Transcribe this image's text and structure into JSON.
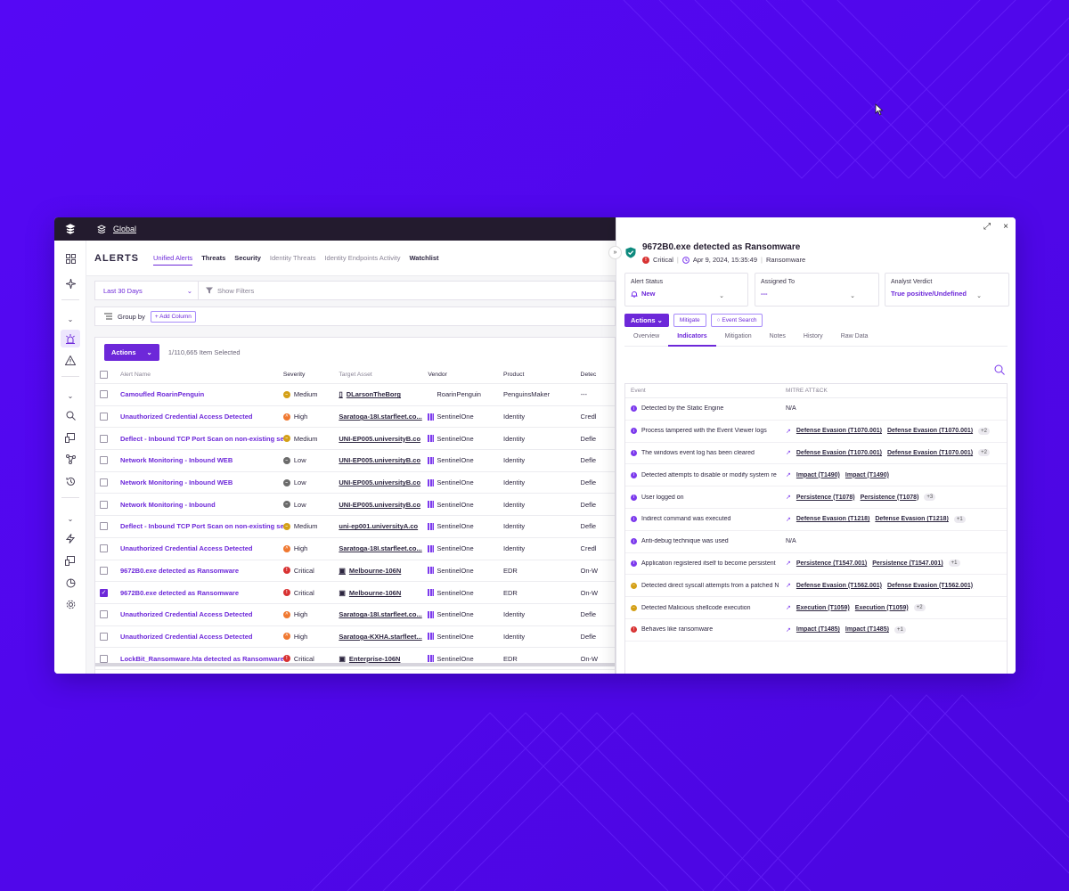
{
  "colors": {
    "accent": "#6d28d9",
    "background": "#5a0ff0",
    "topbar": "#231b2e"
  },
  "topbar": {
    "scope": "Global"
  },
  "header": {
    "title": "ALERTS",
    "tabs": [
      "Unified Alerts",
      "Threats",
      "Security",
      "Identity Threats",
      "Identity Endpoints Activity",
      "Watchlist"
    ]
  },
  "filters": {
    "date_range": "Last 30 Days",
    "show_filters": "Show Filters"
  },
  "group": {
    "label": "Group by",
    "add_column": "+ Add Column"
  },
  "table": {
    "actions_label": "Actions",
    "selection": "1/110,665 Item Selected",
    "columns": [
      "Alert Name",
      "Severity",
      "Target Asset",
      "Vendor",
      "Product",
      "Detec"
    ],
    "rows": [
      {
        "name": "Camoufled RoarinPenguin",
        "severity": "Medium",
        "asset": "DLarsonTheBorg",
        "vendor": "RoarinPenguin",
        "product": "PenguinsMaker",
        "detection": "---"
      },
      {
        "name": "Unauthorized Credential Access Detected",
        "severity": "High",
        "asset": "Saratoga-18I.starfleet.co...",
        "vendor": "SentinelOne",
        "product": "Identity",
        "detection": "Credl"
      },
      {
        "name": "Deflect - Inbound TCP Port Scan on non-existing serv",
        "severity": "Medium",
        "asset": "UNI-EP005.universityB.co",
        "vendor": "SentinelOne",
        "product": "Identity",
        "detection": "Defle"
      },
      {
        "name": "Network Monitoring - Inbound WEB",
        "severity": "Low",
        "asset": "UNI-EP005.universityB.co",
        "vendor": "SentinelOne",
        "product": "Identity",
        "detection": "Defle"
      },
      {
        "name": "Network Monitoring - Inbound WEB",
        "severity": "Low",
        "asset": "UNI-EP005.universityB.co",
        "vendor": "SentinelOne",
        "product": "Identity",
        "detection": "Defle"
      },
      {
        "name": "Network Monitoring - Inbound",
        "severity": "Low",
        "asset": "UNI-EP005.universityB.co",
        "vendor": "SentinelOne",
        "product": "Identity",
        "detection": "Defle"
      },
      {
        "name": "Deflect - Inbound TCP Port Scan on non-existing serv",
        "severity": "Medium",
        "asset": "uni-ep001.universityA.co",
        "vendor": "SentinelOne",
        "product": "Identity",
        "detection": "Defle"
      },
      {
        "name": "Unauthorized Credential Access Detected",
        "severity": "High",
        "asset": "Saratoga-18I.starfleet.co...",
        "vendor": "SentinelOne",
        "product": "Identity",
        "detection": "Credl"
      },
      {
        "name": "9672B0.exe detected as Ransomware",
        "severity": "Critical",
        "asset": "Melbourne-106N",
        "vendor": "SentinelOne",
        "product": "EDR",
        "detection": "On-W"
      },
      {
        "name": "9672B0.exe detected as Ransomware",
        "severity": "Critical",
        "asset": "Melbourne-106N",
        "vendor": "SentinelOne",
        "product": "EDR",
        "detection": "On-W"
      },
      {
        "name": "Unauthorized Credential Access Detected",
        "severity": "High",
        "asset": "Saratoga-18I.starfleet.co...",
        "vendor": "SentinelOne",
        "product": "Identity",
        "detection": "Defle"
      },
      {
        "name": "Unauthorized Credential Access Detected",
        "severity": "High",
        "asset": "Saratoga-KXHA.starfleet...",
        "vendor": "SentinelOne",
        "product": "Identity",
        "detection": "Defle"
      },
      {
        "name": "LockBit_Ransomware.hta detected as Ransomware",
        "severity": "Critical",
        "asset": "Enterprise-106N",
        "vendor": "SentinelOne",
        "product": "EDR",
        "detection": "On-W"
      }
    ]
  },
  "panel": {
    "title": "9672B0.exe detected as Ransomware",
    "severity": "Critical",
    "timestamp": "Apr 9, 2024, 15:35:49",
    "classification": "Ransomware",
    "alert_status": {
      "label": "Alert Status",
      "value": "New"
    },
    "assigned_to": {
      "label": "Assigned To",
      "value": "---"
    },
    "verdict": {
      "label": "Analyst Verdict",
      "value": "True positive/Undefined"
    },
    "actions_label": "Actions",
    "mitigate_label": "Mitigate",
    "event_search_label": "Event Search",
    "tabs": [
      "Overview",
      "Indicators",
      "Mitigation",
      "Notes",
      "History",
      "Raw Data"
    ],
    "columns": [
      "Event",
      "MITRE ATT&CK"
    ],
    "indicators": [
      {
        "event": "Detected by the Static Engine",
        "level": "info",
        "tech1": "",
        "tech2": "",
        "more": "",
        "na": "N/A"
      },
      {
        "event": "Process tampered with the Event Viewer logs",
        "level": "info",
        "tech1": "Defense Evasion (T1070.001)",
        "tech2": "Defense Evasion (T1070.001)",
        "more": "+2",
        "na": ""
      },
      {
        "event": "The windows event log has been cleared",
        "level": "info",
        "tech1": "Defense Evasion (T1070.001)",
        "tech2": "Defense Evasion (T1070.001)",
        "more": "+2",
        "na": ""
      },
      {
        "event": "Detected attempts to disable or modify system re",
        "level": "info",
        "tech1": "Impact (T1490)",
        "tech2": "Impact (T1490)",
        "more": "",
        "na": ""
      },
      {
        "event": "User logged on",
        "level": "info",
        "tech1": "Persistence (T1078)",
        "tech2": "Persistence (T1078)",
        "more": "+3",
        "na": ""
      },
      {
        "event": "Indirect command was executed",
        "level": "info",
        "tech1": "Defense Evasion (T1218)",
        "tech2": "Defense Evasion (T1218)",
        "more": "+1",
        "na": ""
      },
      {
        "event": "Anti-debug technique was used",
        "level": "info",
        "tech1": "",
        "tech2": "",
        "more": "",
        "na": "N/A"
      },
      {
        "event": "Application registered itself to become persistent",
        "level": "info",
        "tech1": "Persistence (T1547.001)",
        "tech2": "Persistence (T1547.001)",
        "more": "+1",
        "na": ""
      },
      {
        "event": "Detected direct syscall attempts from a patched N",
        "level": "med",
        "tech1": "Defense Evasion (T1562.001)",
        "tech2": "Defense Evasion (T1562.001)",
        "more": "",
        "na": ""
      },
      {
        "event": "Detected Malicious shellcode execution",
        "level": "med",
        "tech1": "Execution (T1059)",
        "tech2": "Execution (T1059)",
        "more": "+2",
        "na": ""
      },
      {
        "event": "Behaves like ransomware",
        "level": "crit",
        "tech1": "Impact (T1485)",
        "tech2": "Impact (T1485)",
        "more": "+1",
        "na": ""
      }
    ]
  }
}
